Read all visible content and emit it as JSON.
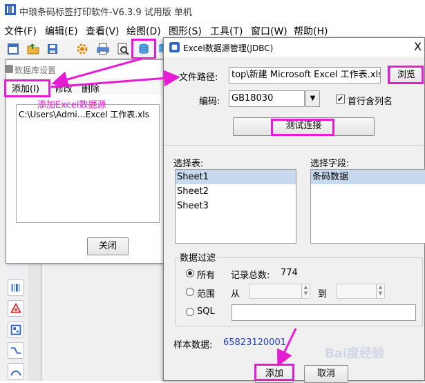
{
  "app": {
    "title": "中琅条码标签打印软件-V6.3.9 试用版 单机",
    "menus": [
      "文件(F)",
      "编辑(E)",
      "查看(V)",
      "绘图(D)",
      "图形(S)",
      "工具(T)",
      "窗口(W)",
      "帮助(H)"
    ]
  },
  "db_dialog": {
    "title": "数据库设置",
    "menu": {
      "add": "添加(I)",
      "modify": "修改",
      "delete": "删除"
    },
    "list_item": "C:\\Users\\Admi…Excel 工作表.xls",
    "close_label": "关闭"
  },
  "annotation": "添加Excel数据源",
  "excel_dialog": {
    "title": "Excel数据源管理(JDBC)",
    "close_glyph": "X",
    "path_label": "文件路径:",
    "path_value": "top\\新建 Microsoft Excel 工作表.xls",
    "browse_label": "浏览",
    "encoding_label": "编码:",
    "encoding_value": "GB18030",
    "header_checkbox_label": "首行含列名",
    "test_button": "测试连接",
    "select_table_label": "选择表:",
    "tables": [
      "Sheet1",
      "Sheet2",
      "Sheet3"
    ],
    "select_field_label": "选择字段:",
    "fields": [
      "条码数据"
    ],
    "filter_legend": "数据过滤",
    "radio_all": "所有",
    "total_label": "记录总数:",
    "total_value": "774",
    "radio_range": "范围",
    "from_label": "从",
    "to_label": "到",
    "radio_sql": "SQL",
    "sample_label": "样本数据:",
    "sample_value": "65823120001",
    "add_button": "添加",
    "cancel_button": "取消"
  },
  "watermark": "Bai度经验",
  "colors": {
    "highlight": "#e61bd6",
    "sample": "#1a3fbf",
    "selection": "#c7d9ef"
  }
}
